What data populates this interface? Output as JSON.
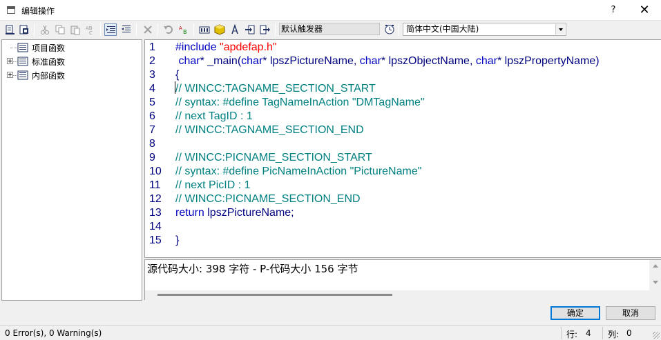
{
  "window": {
    "title": "编辑操作",
    "help_label": "?",
    "close_label": "✕"
  },
  "toolbar": {
    "trigger_label": "默认触发器",
    "language": "简体中文(中国大陆)"
  },
  "tree": {
    "items": [
      {
        "label": "项目函数"
      },
      {
        "label": "标准函数"
      },
      {
        "label": "内部函数"
      }
    ]
  },
  "editor": {
    "lines": [
      {
        "num": "1"
      },
      {
        "num": "2"
      },
      {
        "num": "3"
      },
      {
        "num": "4"
      },
      {
        "num": "5"
      },
      {
        "num": "6"
      },
      {
        "num": "7"
      },
      {
        "num": "8"
      },
      {
        "num": "9"
      },
      {
        "num": "10"
      },
      {
        "num": "11"
      },
      {
        "num": "12"
      },
      {
        "num": "13"
      },
      {
        "num": "14"
      },
      {
        "num": "15"
      }
    ],
    "code": {
      "l1_kw": "#include ",
      "l1_str": "\"apdefap.h\"",
      "l2_a": " char",
      "l2_b": "* _main(",
      "l2_c": "char",
      "l2_d": "* lpszPictureName, ",
      "l2_e": "char",
      "l2_f": "* lpszObjectName, ",
      "l2_g": "char",
      "l2_h": "* lpszPropertyName)",
      "l3": "{",
      "l4": "// WINCC:TAGNAME_SECTION_START",
      "l5": "// syntax: #define TagNameInAction \"DMTagName\"",
      "l6": "// next TagID : 1",
      "l7": "// WINCC:TAGNAME_SECTION_END",
      "l9": "// WINCC:PICNAME_SECTION_START",
      "l10": "// syntax: #define PicNameInAction \"PictureName\"",
      "l11": "// next PicID : 1",
      "l12": "// WINCC:PICNAME_SECTION_END",
      "l13_kw": "return",
      "l13_rest": " lpszPictureName;",
      "l15": "}"
    }
  },
  "output": {
    "text": "源代码大小: 398 字符 - P-代码大小 156 字节"
  },
  "buttons": {
    "ok": "确定",
    "cancel": "取消"
  },
  "status": {
    "message": "0 Error(s), 0 Warning(s)",
    "row_label": "行:",
    "row_value": "4",
    "col_label": "列:",
    "col_value": "0"
  }
}
